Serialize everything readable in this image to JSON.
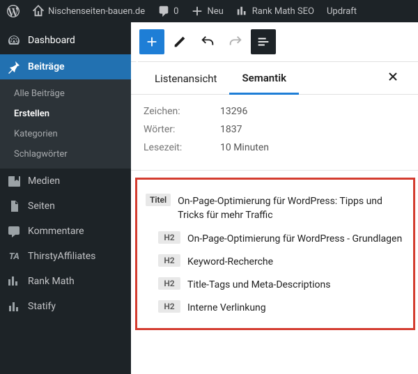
{
  "adminbar": {
    "site_name": "Nischenseiten-bauen.de",
    "comments_count": "0",
    "new_label": "Neu",
    "rankmath_label": "Rank Math SEO",
    "updraft_label": "Updraft"
  },
  "sidebar": {
    "dashboard": "Dashboard",
    "posts": "Beiträge",
    "posts_sub": {
      "all": "Alle Beiträge",
      "new": "Erstellen",
      "categories": "Kategorien",
      "tags": "Schlagwörter"
    },
    "media": "Medien",
    "pages": "Seiten",
    "comments": "Kommentare",
    "thirsty": "ThirstyAffiliates",
    "rankmath": "Rank Math",
    "statify": "Statify"
  },
  "editor": {
    "tabs": {
      "list": "Listenansicht",
      "semantic": "Semantik"
    },
    "stats": {
      "chars_label": "Zeichen:",
      "chars_value": "13296",
      "words_label": "Wörter:",
      "words_value": "1837",
      "readtime_label": "Lesezeit:",
      "readtime_value": "10 Minuten"
    },
    "outline": {
      "title_badge": "Titel",
      "h2_badge": "H2",
      "title": "On-Page-Optimierung für WordPress: Tipps und Tricks für mehr Traffic",
      "h2_1": "On-Page-Optimierung für WordPress - Grundlagen",
      "h2_2": "Keyword-Recherche",
      "h2_3": "Title-Tags und Meta-Descriptions",
      "h2_4": "Interne Verlinkung"
    }
  }
}
